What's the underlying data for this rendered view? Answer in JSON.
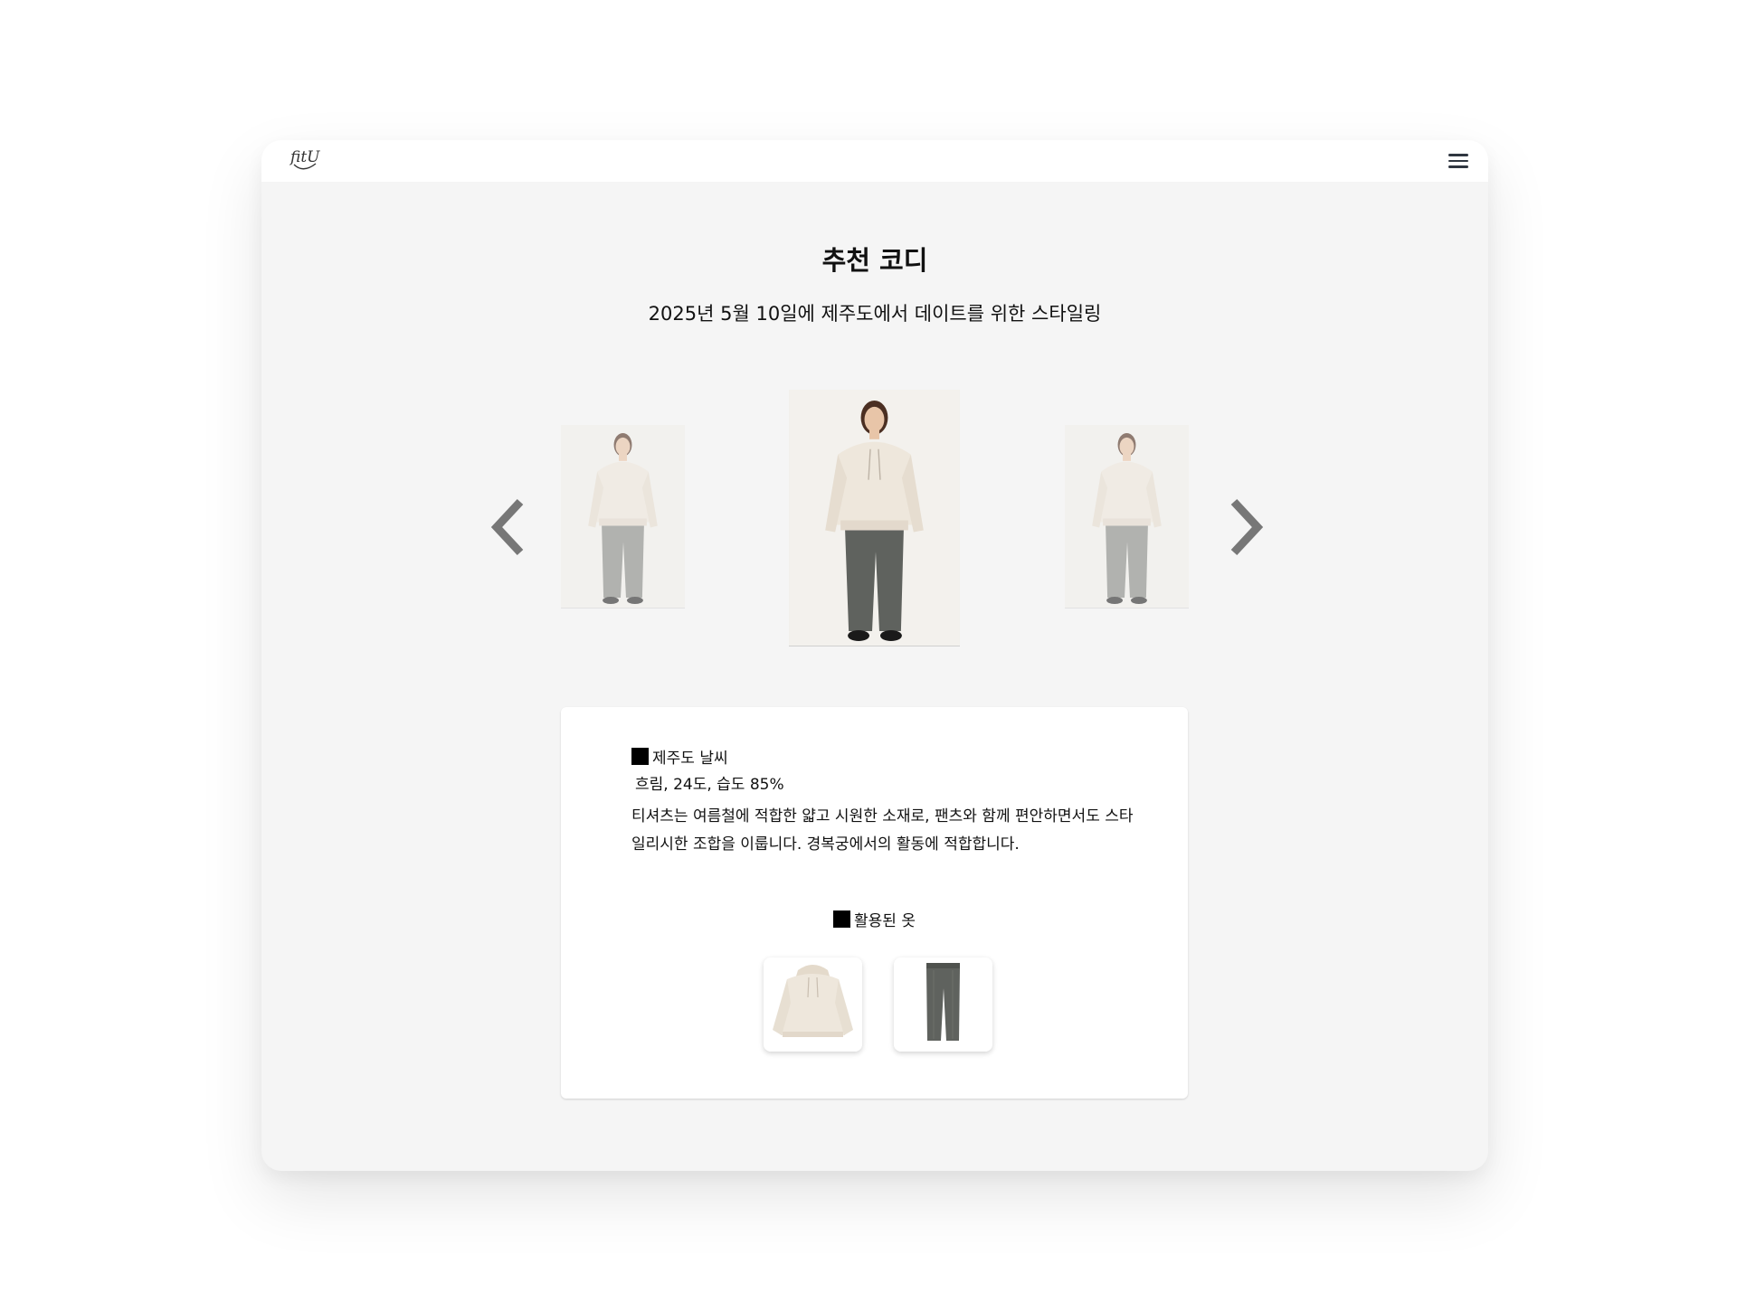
{
  "brand": {
    "logo_text": "fitU"
  },
  "navbar": {
    "menu_icon": "hamburger-menu-icon"
  },
  "page": {
    "title": "추천 코디",
    "subtitle": "2025년 5월 10일에 제주도에서 데이트를 위한 스타일링"
  },
  "carousel": {
    "prev_icon": "chevron-left-icon",
    "next_icon": "chevron-right-icon",
    "arrow_color": "#777777",
    "items": [
      {
        "position": "left",
        "outfit": "cream hoodie + gray wide pants"
      },
      {
        "position": "center",
        "outfit": "cream hoodie + gray wide pants"
      },
      {
        "position": "right",
        "outfit": "cream hoodie + gray wide pants"
      }
    ]
  },
  "info": {
    "weather_heading": "제주도 날씨",
    "weather_value": "흐림, 24도, 습도 85%",
    "description": "티셔츠는 여름철에 적합한 얇고 시원한 소재로, 팬츠와 함께 편안하면서도 스타일리시한 조합을 이룹니다. 경복궁에서의 활동에 적합합니다.",
    "clothes_heading": "활용된 옷",
    "clothes": [
      {
        "name": "hoodie",
        "color": "#eee7dc"
      },
      {
        "name": "wide-pants",
        "color": "#5f625e"
      }
    ]
  },
  "colors": {
    "background": "#f5f5f5",
    "card": "#ffffff",
    "hoodie": "#eee7dc",
    "pants": "#5f625e"
  }
}
